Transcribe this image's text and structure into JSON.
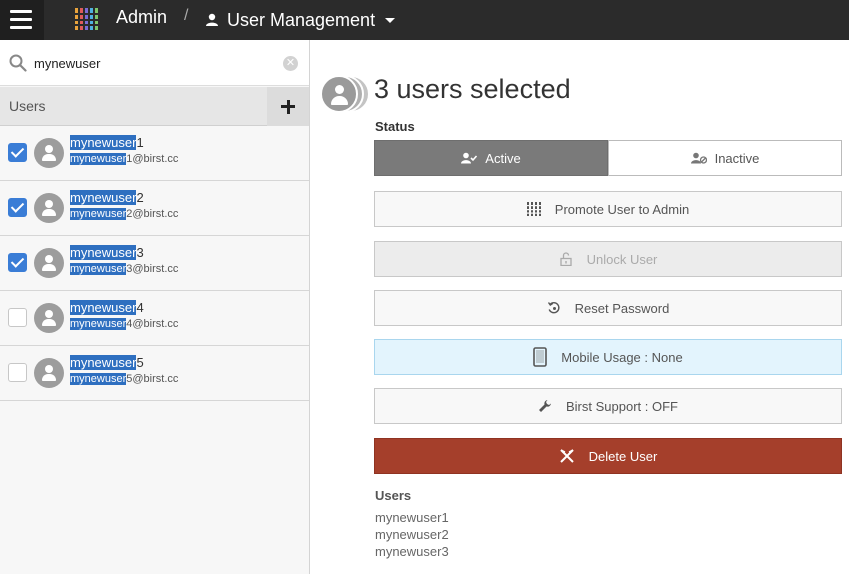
{
  "header": {
    "app_title": "Admin",
    "separator": "/",
    "breadcrumb": "User Management",
    "bg_color": "#2b2b2b"
  },
  "sidebar": {
    "search": {
      "value": "mynewuser",
      "placeholder": ""
    },
    "list_title": "Users",
    "add_icon": "plus-icon",
    "users": [
      {
        "name_match": "mynewuser",
        "name_rest": "1",
        "email_match": "mynewuser",
        "email_rest": "1@birst.cc",
        "checked": true
      },
      {
        "name_match": "mynewuser",
        "name_rest": "2",
        "email_match": "mynewuser",
        "email_rest": "2@birst.cc",
        "checked": true
      },
      {
        "name_match": "mynewuser",
        "name_rest": "3",
        "email_match": "mynewuser",
        "email_rest": "3@birst.cc",
        "checked": true
      },
      {
        "name_match": "mynewuser",
        "name_rest": "4",
        "email_match": "mynewuser",
        "email_rest": "4@birst.cc",
        "checked": false
      },
      {
        "name_match": "mynewuser",
        "name_rest": "5",
        "email_match": "mynewuser",
        "email_rest": "5@birst.cc",
        "checked": false
      }
    ]
  },
  "main": {
    "title": "3 users selected",
    "status_label": "Status",
    "status_active": "Active",
    "status_inactive": "Inactive",
    "actions": {
      "promote": "Promote User to Admin",
      "unlock": "Unlock User",
      "reset": "Reset Password",
      "mobile": "Mobile Usage : None",
      "support": "Birst Support : OFF",
      "delete": "Delete User"
    },
    "users_label": "Users",
    "selected_users": [
      "mynewuser1",
      "mynewuser2",
      "mynewuser3"
    ],
    "colors": {
      "active_toggle": "#7a7a7a",
      "delete": "#a53f2b",
      "mobile_bg": "#e3f4fd",
      "checkbox": "#3a7dd6",
      "highlight": "#2e6fc0"
    }
  }
}
